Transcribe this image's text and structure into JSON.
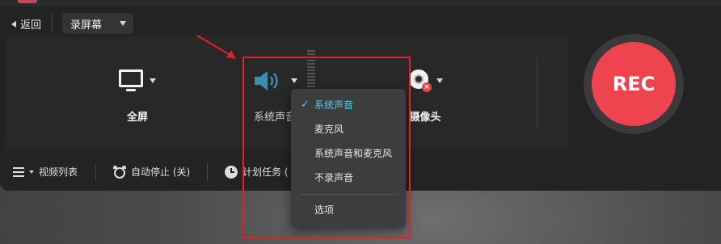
{
  "header": {
    "back_label": "返回",
    "mode_value": "录屏幕"
  },
  "sources": {
    "screen_label": "全屏",
    "audio_label": "系统声音",
    "camera_label": "摄像头"
  },
  "rec_label": "REC",
  "bottom": {
    "video_list": "视频列表",
    "auto_stop": "自动停止 (关)",
    "schedule": "计划任务 ("
  },
  "dropdown": {
    "check_mark": "✓",
    "items": [
      "系统声音",
      "麦克风",
      "系统声音和麦克风",
      "不录声音"
    ],
    "selected_index": 0,
    "options_label": "选项"
  },
  "colors": {
    "rec": "#ef4350",
    "selected": "#55c8ef",
    "annotation": "#e0212b"
  },
  "icons": [
    "back-arrow-icon",
    "chevron-down-icon",
    "monitor-icon",
    "speaker-icon",
    "webcam-icon",
    "list-icon",
    "alarm-clock-icon",
    "clock-icon",
    "check-icon"
  ]
}
